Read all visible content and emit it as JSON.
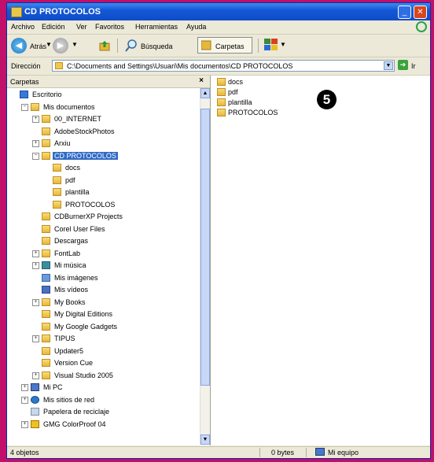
{
  "window": {
    "title": "CD PROTOCOLOS",
    "controls": [
      "minimize-icon",
      "close-icon"
    ]
  },
  "menu": [
    "Archivo",
    "Edición",
    "Ver",
    "Favoritos",
    "Herramientas",
    "Ayuda"
  ],
  "toolbar": {
    "back_label": "Atrás",
    "search_label": "Búsqueda",
    "folders_label": "Carpetas"
  },
  "address": {
    "label": "Dirección",
    "path": "C:\\Documents and Settings\\Usuari\\Mis documentos\\CD PROTOCOLOS",
    "go_label": "Ir"
  },
  "folder_pane": {
    "title": "Carpetas",
    "close": "×",
    "tree": [
      {
        "label": "Escritorio",
        "icon": "desktop-icon",
        "expander": ""
      },
      {
        "label": "Mis documentos",
        "icon": "my-documents-icon",
        "expander": "−"
      },
      {
        "label": "00_INTERNET",
        "icon": "folder-icon",
        "expander": "+"
      },
      {
        "label": "AdobeStockPhotos",
        "icon": "folder-icon",
        "expander": ""
      },
      {
        "label": "Arxiu",
        "icon": "folder-icon",
        "expander": "+"
      },
      {
        "label": "CD PROTOCOLOS",
        "icon": "folder-icon",
        "expander": "−",
        "selected": true
      },
      {
        "label": "docs",
        "icon": "folder-icon",
        "expander": ""
      },
      {
        "label": "pdf",
        "icon": "folder-icon",
        "expander": ""
      },
      {
        "label": "plantilla",
        "icon": "folder-icon",
        "expander": ""
      },
      {
        "label": "PROTOCOLOS",
        "icon": "folder-icon",
        "expander": ""
      },
      {
        "label": "CDBurnerXP Projects",
        "icon": "folder-icon",
        "expander": ""
      },
      {
        "label": "Corel User Files",
        "icon": "folder-icon",
        "expander": ""
      },
      {
        "label": "Descargas",
        "icon": "folder-icon",
        "expander": ""
      },
      {
        "label": "FontLab",
        "icon": "folder-icon",
        "expander": "+"
      },
      {
        "label": "Mi música",
        "icon": "music-folder-icon",
        "expander": "+"
      },
      {
        "label": "Mis imágenes",
        "icon": "pictures-folder-icon",
        "expander": ""
      },
      {
        "label": "Mis vídeos",
        "icon": "videos-folder-icon",
        "expander": ""
      },
      {
        "label": "My Books",
        "icon": "folder-icon",
        "expander": "+"
      },
      {
        "label": "My Digital Editions",
        "icon": "folder-icon",
        "expander": ""
      },
      {
        "label": "My Google Gadgets",
        "icon": "folder-icon",
        "expander": ""
      },
      {
        "label": "TIPUS",
        "icon": "folder-icon",
        "expander": "+"
      },
      {
        "label": "Updater5",
        "icon": "folder-icon",
        "expander": ""
      },
      {
        "label": "Version Cue",
        "icon": "folder-icon",
        "expander": ""
      },
      {
        "label": "Visual Studio 2005",
        "icon": "folder-icon",
        "expander": "+"
      },
      {
        "label": "Mi PC",
        "icon": "my-computer-icon",
        "expander": "+"
      },
      {
        "label": "Mis sitios de red",
        "icon": "network-icon",
        "expander": "+"
      },
      {
        "label": "Papelera de reciclaje",
        "icon": "recycle-bin-icon",
        "expander": ""
      },
      {
        "label": "GMG ColorProof 04",
        "icon": "gmg-folder-icon",
        "expander": "+"
      }
    ]
  },
  "files": [
    "docs",
    "pdf",
    "plantilla",
    "PROTOCOLOS"
  ],
  "callout": "5",
  "status": {
    "objects": "4 objetos",
    "size": "0 bytes",
    "location": "Mi equipo"
  },
  "colors": {
    "frame": "#c0106a",
    "titlebar": "#1458d6",
    "selection": "#316ac5",
    "folder": "#e6b83a"
  }
}
